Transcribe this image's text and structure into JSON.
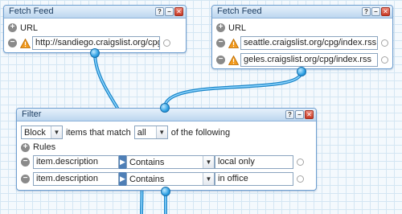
{
  "colors": {
    "wire": "#3ab0ea",
    "module_border": "#6f9fd0",
    "warning": "#f29a1d"
  },
  "fetch_left": {
    "title": "Fetch Feed",
    "url_label": "URL",
    "urls": [
      "http://sandiego.craigslist.org/cpg/i"
    ]
  },
  "fetch_right": {
    "title": "Fetch Feed",
    "url_label": "URL",
    "urls": [
      "seattle.craigslist.org/cpg/index.rss",
      "geles.craigslist.org/cpg/index.rss"
    ]
  },
  "filter": {
    "title": "Filter",
    "mode_value": "Block",
    "text_middle": "items that match",
    "match_value": "all",
    "text_end": "of the following",
    "rules_label": "Rules",
    "rules": [
      {
        "field": "item.description",
        "operator": "Contains",
        "value": "local only"
      },
      {
        "field": "item.description",
        "operator": "Contains",
        "value": "in office"
      }
    ]
  },
  "window_buttons": {
    "help": "?",
    "minimize": "–",
    "close": "✕"
  }
}
